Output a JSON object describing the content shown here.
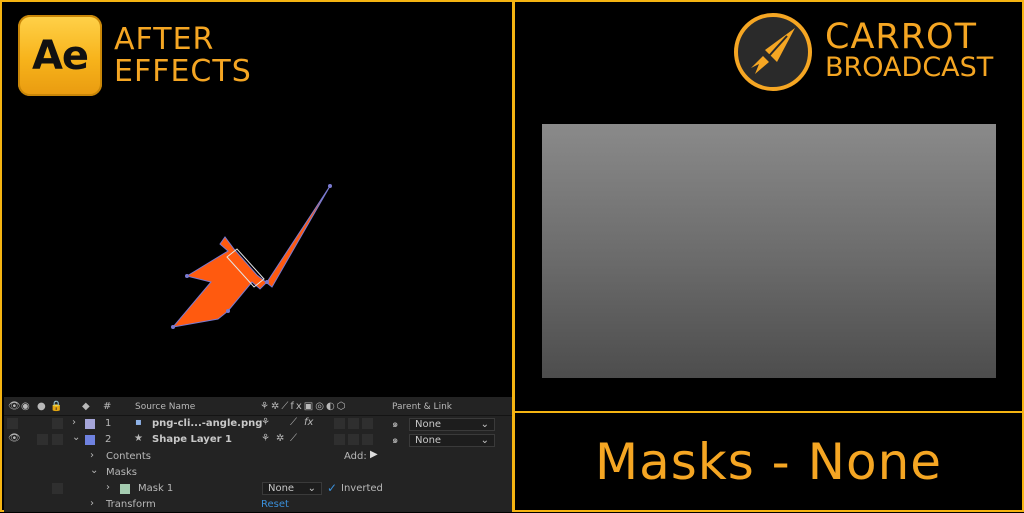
{
  "colors": {
    "accent": "#f5a623",
    "border": "#f5b412",
    "shape_fill": "#ff5a0f",
    "layer1_label": "#a4a4d8",
    "layer2_label": "#6f82e0",
    "mask_color": "#a4ccb0"
  },
  "branding": {
    "ae_logo_text": "Ae",
    "ae_title_line1": "AFTER",
    "ae_title_line2": "EFFECTS",
    "cb_title_line1": "CARROT",
    "cb_title_line2": "BROADCAST"
  },
  "timeline": {
    "header": {
      "hash": "#",
      "source_name": "Source Name",
      "parent_link": "Parent & Link"
    },
    "layers": [
      {
        "num": "1",
        "name": "png-cli...-angle.png",
        "parent": "None",
        "icon": "image-icon"
      },
      {
        "num": "2",
        "name": "Shape Layer 1",
        "parent": "None",
        "icon": "star-icon"
      }
    ],
    "props": {
      "contents": "Contents",
      "add_label": "Add:",
      "masks": "Masks",
      "mask1": "Mask 1",
      "mask_mode": "None",
      "inverted": "Inverted",
      "transform": "Transform",
      "reset": "Reset"
    }
  },
  "title_text": "Masks - None"
}
